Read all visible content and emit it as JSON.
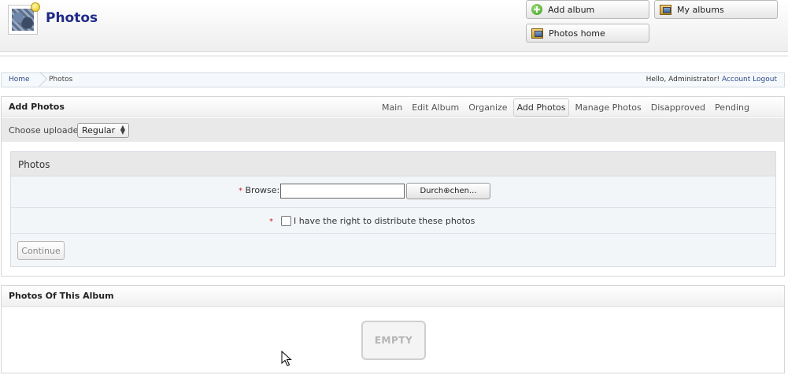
{
  "header": {
    "title": "Photos",
    "buttons": {
      "add_album": "Add album",
      "my_albums": "My albums",
      "photos_home": "Photos home"
    }
  },
  "breadcrumb": {
    "items": [
      "Home",
      "Photos"
    ],
    "greeting": "Hello, Administrator!",
    "account": "Account",
    "logout": "Logout"
  },
  "add_photos": {
    "title": "Add Photos",
    "tabs": [
      "Main",
      "Edit Album",
      "Organize",
      "Add Photos",
      "Manage Photos",
      "Disapproved",
      "Pending"
    ],
    "active_tab": "Add Photos",
    "uploader_label": "Choose uploader",
    "uploader_value": "Regular",
    "form": {
      "title": "Photos",
      "required_mark": "*",
      "browse_label": "Browse:",
      "file_button": "Durch⊕chen...",
      "rights_label": "I have the right to distribute these photos",
      "continue": "Continue"
    }
  },
  "album_photos": {
    "title": "Photos Of This Album",
    "empty_label": "EMPTY"
  }
}
